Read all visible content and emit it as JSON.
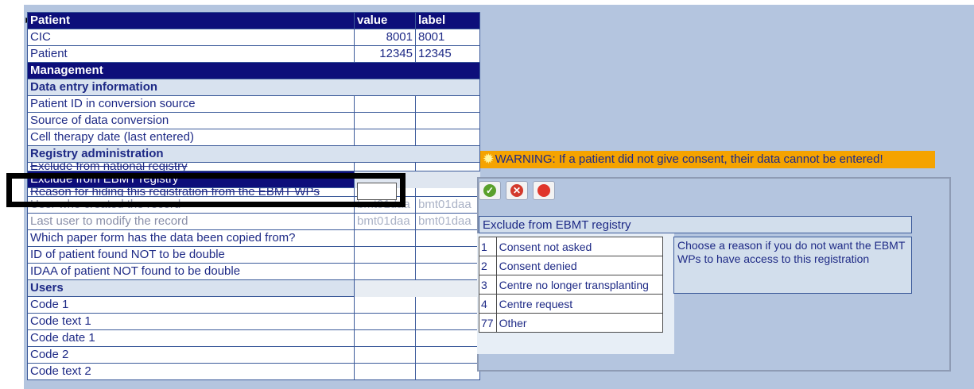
{
  "grid": {
    "header": {
      "patient": "Patient",
      "value": "value",
      "label": "label"
    },
    "rows": {
      "cic": {
        "label": "CIC",
        "value": "8001",
        "lbl": "8001"
      },
      "patient": {
        "label": "Patient",
        "value": "12345",
        "lbl": "12345"
      },
      "management": "Management",
      "data_entry": "Data entry information",
      "patient_id": "Patient ID in conversion source",
      "source": "Source of data conversion",
      "cell_therapy": "Cell therapy date (last entered)",
      "registry_admin": "Registry administration",
      "exclude_national": "Exclude from national registry",
      "exclude_ebmt": "Exclude from EBMT registry",
      "reason_hiding": "Reason for hiding this registration from the EBMT WPs",
      "user_created": {
        "label": "User who created the record",
        "value": "bmt01daa",
        "lbl": "bmt01daa"
      },
      "last_user": {
        "label": "Last user to modify the record",
        "value": "bmt01daa",
        "lbl": "bmt01daa"
      },
      "paper_form": "Which paper form has the data been copied from?",
      "id_not_double": "ID of patient found NOT to be double",
      "idaa_not_double": "IDAA of patient NOT found to be double",
      "users": "Users",
      "code1": "Code 1",
      "code_text1": "Code text 1",
      "code_date1": "Code date 1",
      "code2": "Code 2",
      "code_text2": "Code text 2"
    }
  },
  "warning": {
    "text": "WARNING: If a patient did not give consent, their data cannot be entered!",
    "color": "#f5a300"
  },
  "popup": {
    "title": "Exclude from EBMT registry",
    "buttons": [
      "ok-icon",
      "cancel-icon",
      "stop-icon"
    ],
    "options": [
      {
        "code": "1",
        "label": "Consent not asked"
      },
      {
        "code": "2",
        "label": "Consent denied"
      },
      {
        "code": "3",
        "label": "Centre no longer transplanting"
      },
      {
        "code": "4",
        "label": "Centre request"
      },
      {
        "code": "77",
        "label": "Other"
      }
    ],
    "help": "Choose a reason if you do not want the EBMT WPs to have access to this registration"
  },
  "colors": {
    "header": "#0d0e7a",
    "section": "#d8e2ef",
    "background": "#b4c5df",
    "highlight": "#000000"
  }
}
